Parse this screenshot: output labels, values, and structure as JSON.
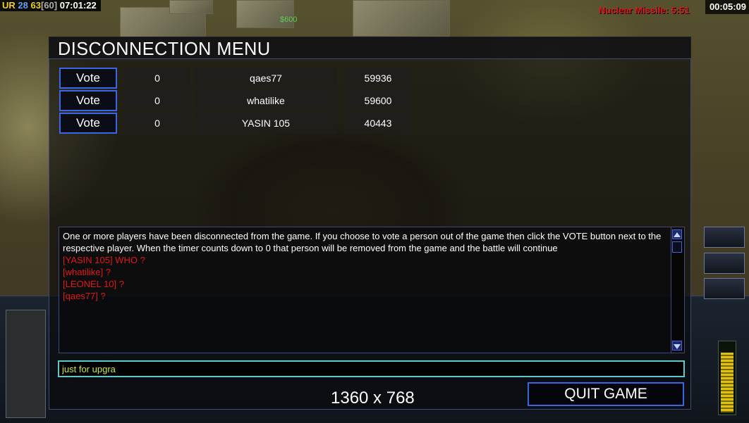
{
  "hud": {
    "top_left": {
      "ur": "UR",
      "num1": "28",
      "num2": "63",
      "num3": "[60]",
      "clock": "07:01:22"
    },
    "missile": "Nuclear Missile: 5:51",
    "game_time": "00:05:09",
    "money_float": "$600"
  },
  "menu": {
    "title": "DISCONNECTION MENU",
    "vote_label": "Vote",
    "players": [
      {
        "count": "0",
        "name": "qaes77",
        "ping": "59936"
      },
      {
        "count": "0",
        "name": "whatilike",
        "ping": "59600"
      },
      {
        "count": "0",
        "name": "YASIN 105",
        "ping": "40443"
      }
    ],
    "messages": {
      "system": "One or more players have been disconnected from the game. If you choose to vote a person out of the game then click the VOTE button next to the respective player. When the timer counts down to 0 that person will be removed from the game and the battle will continue",
      "chat": [
        "[YASIN 105] WHO ?",
        "[whatilike] ?",
        "[LEONEL 10] ?",
        "[qaes77] ?"
      ]
    },
    "chat_input_value": "just for upgra",
    "resolution_label": "1360 x 768",
    "quit_label": "QUIT GAME"
  },
  "colors": {
    "accent_blue": "#3a66e6",
    "chat_red": "#e01818",
    "input_border": "#5fc8c8",
    "input_text": "#c8e83a"
  },
  "power_level": 0.9
}
